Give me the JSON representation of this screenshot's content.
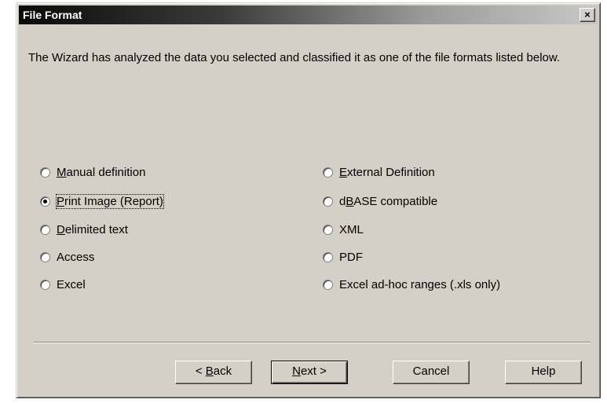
{
  "window": {
    "title": "File Format",
    "close_label": "×"
  },
  "description": "The Wizard has analyzed the data you selected and classified it as one of the file formats listed below.",
  "options_left": [
    {
      "pre": "",
      "ul": "M",
      "post": "anual definition",
      "checked": false
    },
    {
      "pre": "",
      "ul": "P",
      "post": "rint Image (Report)",
      "checked": true
    },
    {
      "pre": "",
      "ul": "D",
      "post": "elimited text",
      "checked": false
    },
    {
      "pre": "",
      "ul": "",
      "post": "Access",
      "checked": false
    },
    {
      "pre": "",
      "ul": "",
      "post": "Excel",
      "checked": false
    }
  ],
  "options_right": [
    {
      "pre": "",
      "ul": "E",
      "post": "xternal Definition",
      "checked": false
    },
    {
      "pre": "d",
      "ul": "B",
      "post": "ASE compatible",
      "checked": false
    },
    {
      "pre": "",
      "ul": "",
      "post": "XML",
      "checked": false
    },
    {
      "pre": "",
      "ul": "",
      "post": "PDF",
      "checked": false
    },
    {
      "pre": "",
      "ul": "",
      "post": "Excel ad-hoc ranges (.xls only)",
      "checked": false
    }
  ],
  "buttons": {
    "back": {
      "pre": "< ",
      "ul": "B",
      "post": "ack"
    },
    "next": {
      "pre": "",
      "ul": "N",
      "post": "ext >"
    },
    "cancel": {
      "pre": "",
      "ul": "",
      "post": "Cancel"
    },
    "help": {
      "pre": "",
      "ul": "",
      "post": "Help"
    }
  }
}
